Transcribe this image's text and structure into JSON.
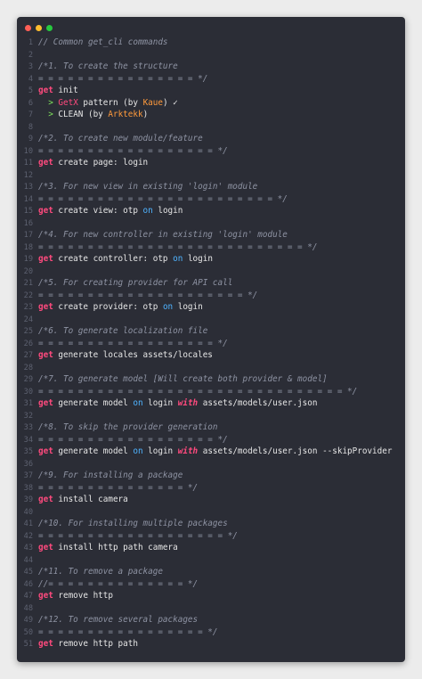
{
  "window": {
    "title": ""
  },
  "lines": [
    {
      "n": "1",
      "tokens": [
        {
          "t": "comment",
          "v": "// Common get_cli commands"
        }
      ]
    },
    {
      "n": "2",
      "tokens": []
    },
    {
      "n": "3",
      "tokens": [
        {
          "t": "comment",
          "v": "/*1. To create the structure"
        }
      ]
    },
    {
      "n": "4",
      "tokens": [
        {
          "t": "comment",
          "v": "= = = = = = = = = = = = = = = = */"
        }
      ]
    },
    {
      "n": "5",
      "tokens": [
        {
          "t": "kw",
          "v": "get"
        },
        {
          "t": "plain",
          "v": " init"
        }
      ]
    },
    {
      "n": "6",
      "tokens": [
        {
          "t": "plain",
          "v": "  "
        },
        {
          "t": "bullet",
          "v": "> "
        },
        {
          "t": "ext",
          "v": "GetX"
        },
        {
          "t": "plain",
          "v": " pattern (by "
        },
        {
          "t": "name",
          "v": "Kaue"
        },
        {
          "t": "plain",
          "v": ") ✓"
        }
      ]
    },
    {
      "n": "7",
      "tokens": [
        {
          "t": "plain",
          "v": "  "
        },
        {
          "t": "bullet",
          "v": "> "
        },
        {
          "t": "plain",
          "v": "CLEAN (by "
        },
        {
          "t": "name",
          "v": "Arktekk"
        },
        {
          "t": "plain",
          "v": ")"
        }
      ]
    },
    {
      "n": "8",
      "tokens": []
    },
    {
      "n": "9",
      "tokens": [
        {
          "t": "comment",
          "v": "/*2. To create new module/feature"
        }
      ]
    },
    {
      "n": "10",
      "tokens": [
        {
          "t": "comment",
          "v": "= = = = = = = = = = = = = = = = = = */"
        }
      ]
    },
    {
      "n": "11",
      "tokens": [
        {
          "t": "kw",
          "v": "get"
        },
        {
          "t": "plain",
          "v": " create page: login"
        }
      ]
    },
    {
      "n": "12",
      "tokens": []
    },
    {
      "n": "13",
      "tokens": [
        {
          "t": "comment",
          "v": "/*3. For new view in existing 'login' module"
        }
      ]
    },
    {
      "n": "14",
      "tokens": [
        {
          "t": "comment",
          "v": "= = = = = = = = = = = = = = = = = = = = = = = = */"
        }
      ]
    },
    {
      "n": "15",
      "tokens": [
        {
          "t": "kw",
          "v": "get"
        },
        {
          "t": "plain",
          "v": " create view: otp "
        },
        {
          "t": "on",
          "v": "on"
        },
        {
          "t": "plain",
          "v": " login"
        }
      ]
    },
    {
      "n": "16",
      "tokens": []
    },
    {
      "n": "17",
      "tokens": [
        {
          "t": "comment",
          "v": "/*4. For new controller in existing 'login' module"
        }
      ]
    },
    {
      "n": "18",
      "tokens": [
        {
          "t": "comment",
          "v": "= = = = = = = = = = = = = = = = = = = = = = = = = = = */"
        }
      ]
    },
    {
      "n": "19",
      "tokens": [
        {
          "t": "kw",
          "v": "get"
        },
        {
          "t": "plain",
          "v": " create controller: otp "
        },
        {
          "t": "on",
          "v": "on"
        },
        {
          "t": "plain",
          "v": " login"
        }
      ]
    },
    {
      "n": "20",
      "tokens": []
    },
    {
      "n": "21",
      "tokens": [
        {
          "t": "comment",
          "v": "/*5. For creating provider for API call"
        }
      ]
    },
    {
      "n": "22",
      "tokens": [
        {
          "t": "comment",
          "v": "= = = = = = = = = = = = = = = = = = = = = */"
        }
      ]
    },
    {
      "n": "23",
      "tokens": [
        {
          "t": "kw",
          "v": "get"
        },
        {
          "t": "plain",
          "v": " create provider: otp "
        },
        {
          "t": "on",
          "v": "on"
        },
        {
          "t": "plain",
          "v": " login"
        }
      ]
    },
    {
      "n": "24",
      "tokens": []
    },
    {
      "n": "25",
      "tokens": [
        {
          "t": "comment",
          "v": "/*6. To generate localization file"
        }
      ]
    },
    {
      "n": "26",
      "tokens": [
        {
          "t": "comment",
          "v": "= = = = = = = = = = = = = = = = = = */"
        }
      ]
    },
    {
      "n": "27",
      "tokens": [
        {
          "t": "kw",
          "v": "get"
        },
        {
          "t": "plain",
          "v": " generate locales assets/locales"
        }
      ]
    },
    {
      "n": "28",
      "tokens": []
    },
    {
      "n": "29",
      "tokens": [
        {
          "t": "comment",
          "v": "/*7. To generate model [Will create both provider & model]"
        }
      ]
    },
    {
      "n": "30",
      "tokens": [
        {
          "t": "comment",
          "v": "= = = = = = = = = = = = = = = = = = = = = = = = = = = = = = = */"
        }
      ]
    },
    {
      "n": "31",
      "tokens": [
        {
          "t": "kw",
          "v": "get"
        },
        {
          "t": "plain",
          "v": " generate model "
        },
        {
          "t": "on",
          "v": "on"
        },
        {
          "t": "plain",
          "v": " login "
        },
        {
          "t": "with",
          "v": "with"
        },
        {
          "t": "plain",
          "v": " assets/models/user.json"
        }
      ]
    },
    {
      "n": "32",
      "tokens": []
    },
    {
      "n": "33",
      "tokens": [
        {
          "t": "comment",
          "v": "/*8. To skip the provider generation"
        }
      ]
    },
    {
      "n": "34",
      "tokens": [
        {
          "t": "comment",
          "v": "= = = = = = = = = = = = = = = = = = */"
        }
      ]
    },
    {
      "n": "35",
      "tokens": [
        {
          "t": "kw",
          "v": "get"
        },
        {
          "t": "plain",
          "v": " generate model "
        },
        {
          "t": "on",
          "v": "on"
        },
        {
          "t": "plain",
          "v": " login "
        },
        {
          "t": "with",
          "v": "with"
        },
        {
          "t": "plain",
          "v": " assets/models/user.json --skipProvider"
        }
      ]
    },
    {
      "n": "36",
      "tokens": []
    },
    {
      "n": "37",
      "tokens": [
        {
          "t": "comment",
          "v": "/*9. For installing a package"
        }
      ]
    },
    {
      "n": "38",
      "tokens": [
        {
          "t": "comment",
          "v": "= = = = = = = = = = = = = = = */"
        }
      ]
    },
    {
      "n": "39",
      "tokens": [
        {
          "t": "kw",
          "v": "get"
        },
        {
          "t": "plain",
          "v": " install camera"
        }
      ]
    },
    {
      "n": "40",
      "tokens": []
    },
    {
      "n": "41",
      "tokens": [
        {
          "t": "comment",
          "v": "/*10. For installing multiple packages"
        }
      ]
    },
    {
      "n": "42",
      "tokens": [
        {
          "t": "comment",
          "v": "= = = = = = = = = = = = = = = = = = = */"
        }
      ]
    },
    {
      "n": "43",
      "tokens": [
        {
          "t": "kw",
          "v": "get"
        },
        {
          "t": "plain",
          "v": " install http path camera"
        }
      ]
    },
    {
      "n": "44",
      "tokens": []
    },
    {
      "n": "45",
      "tokens": [
        {
          "t": "comment",
          "v": "/*11. To remove a package"
        }
      ]
    },
    {
      "n": "46",
      "tokens": [
        {
          "t": "comment",
          "v": "//= = = = = = = = = = = = = = */"
        }
      ]
    },
    {
      "n": "47",
      "tokens": [
        {
          "t": "kw",
          "v": "get"
        },
        {
          "t": "plain",
          "v": " remove http"
        }
      ]
    },
    {
      "n": "48",
      "tokens": []
    },
    {
      "n": "49",
      "tokens": [
        {
          "t": "comment",
          "v": "/*12. To remove several packages"
        }
      ]
    },
    {
      "n": "50",
      "tokens": [
        {
          "t": "comment",
          "v": "= = = = = = = = = = = = = = = = = */"
        }
      ]
    },
    {
      "n": "51",
      "tokens": [
        {
          "t": "kw",
          "v": "get"
        },
        {
          "t": "plain",
          "v": " remove http path"
        }
      ]
    }
  ],
  "colors": {
    "background": "#2b2d36",
    "comment": "#8e93a3",
    "keyword": "#ff4a7e",
    "on": "#4fb3ff",
    "name": "#ff9a3c",
    "bullet": "#7ee35b",
    "plain": "#e6e6e6"
  }
}
